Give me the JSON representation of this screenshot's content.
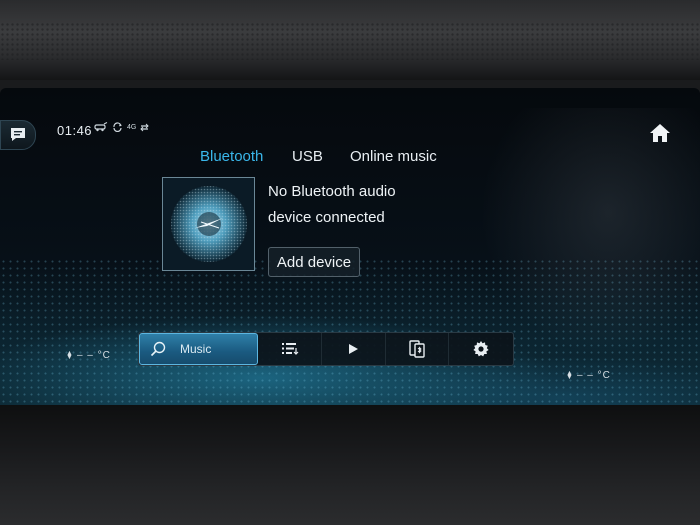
{
  "status": {
    "time": "01:46",
    "network": "4G"
  },
  "tabs": [
    {
      "label": "Bluetooth",
      "active": true
    },
    {
      "label": "USB",
      "active": false
    },
    {
      "label": "Online music",
      "active": false
    }
  ],
  "main": {
    "message_line1": "No Bluetooth audio",
    "message_line2": "device connected",
    "add_device_label": "Add device",
    "art_icon": "bluetooth-disc-icon"
  },
  "bottom_bar": {
    "search_label": "Music",
    "items": [
      "search-icon",
      "queue-list-icon",
      "play-icon",
      "phone-device-icon",
      "gear-icon"
    ]
  },
  "climate": {
    "left_temp": "– – °C",
    "right_temp": "– – °C"
  },
  "colors": {
    "accent": "#3ab7ea",
    "screen_bg": "#071018"
  }
}
